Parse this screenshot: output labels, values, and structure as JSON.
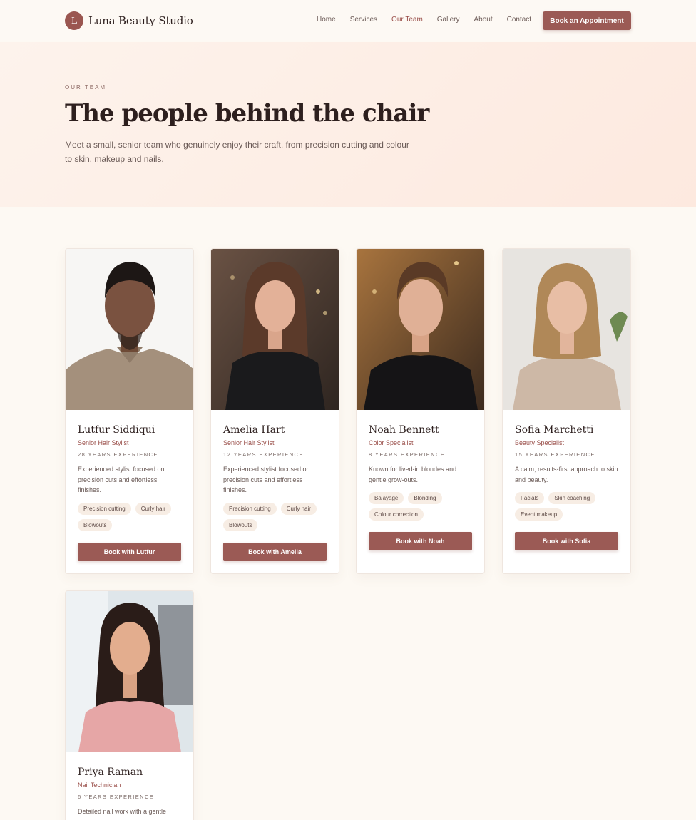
{
  "header": {
    "logo_letter": "L",
    "brand": "Luna Beauty Studio",
    "nav": [
      {
        "label": "Home",
        "active": false
      },
      {
        "label": "Services",
        "active": false
      },
      {
        "label": "Our Team",
        "active": true
      },
      {
        "label": "Gallery",
        "active": false
      },
      {
        "label": "About",
        "active": false
      },
      {
        "label": "Contact",
        "active": false
      }
    ],
    "cta": "Book an Appointment"
  },
  "hero": {
    "eyebrow": "OUR TEAM",
    "title": "The people behind the chair",
    "text": "Meet a small, senior team who genuinely enjoy their craft, from precision cutting and colour to skin, makeup and nails."
  },
  "team": [
    {
      "name": "Lutfur Siddiqui",
      "role": "Senior Hair Stylist",
      "experience": "28 YEARS EXPERIENCE",
      "description": "Experienced stylist focused on precision cuts and effortless finishes.",
      "tags": [
        "Precision cutting",
        "Curly hair",
        "Blowouts"
      ],
      "button": "Book with Lutfur"
    },
    {
      "name": "Amelia Hart",
      "role": "Senior Hair Stylist",
      "experience": "12 YEARS EXPERIENCE",
      "description": "Experienced stylist focused on precision cuts and effortless finishes.",
      "tags": [
        "Precision cutting",
        "Curly hair",
        "Blowouts"
      ],
      "button": "Book with Amelia"
    },
    {
      "name": "Noah Bennett",
      "role": "Color Specialist",
      "experience": "8 YEARS EXPERIENCE",
      "description": "Known for lived-in blondes and gentle grow-outs.",
      "tags": [
        "Balayage",
        "Blonding",
        "Colour correction"
      ],
      "button": "Book with Noah"
    },
    {
      "name": "Sofia Marchetti",
      "role": "Beauty Specialist",
      "experience": "15 YEARS EXPERIENCE",
      "description": "A calm, results-first approach to skin and beauty.",
      "tags": [
        "Facials",
        "Skin coaching",
        "Event makeup"
      ],
      "button": "Book with Sofia"
    },
    {
      "name": "Priya Raman",
      "role": "Nail Technician",
      "experience": "6 YEARS EXPERIENCE",
      "description": "Detailed nail work with a gentle"
    }
  ]
}
